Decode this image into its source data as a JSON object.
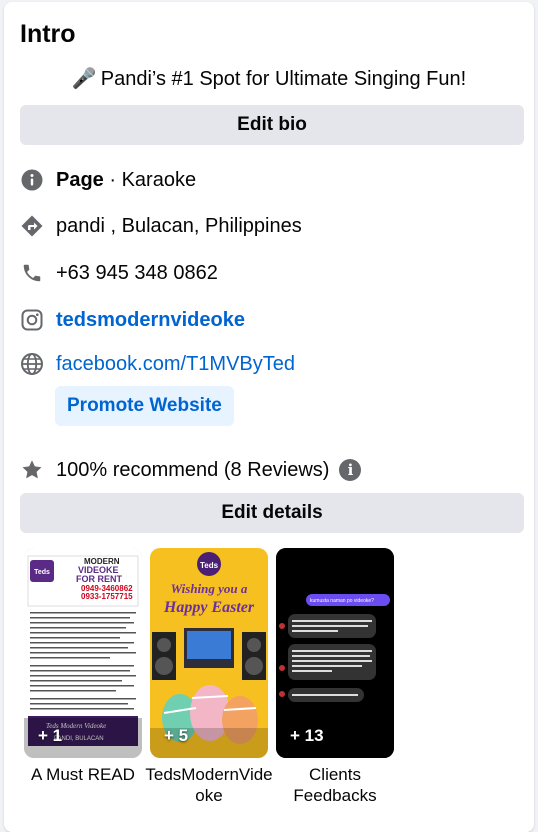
{
  "intro": {
    "title": "Intro",
    "bio_icon": "microphone-icon",
    "bio": "Pandi’s #1 Spot for Ultimate Singing Fun!",
    "edit_bio_label": "Edit bio"
  },
  "details": {
    "page_type_label": "Page",
    "page_type_sep": " · ",
    "category": "Karaoke",
    "location": "pandi , Bulacan, Philippines",
    "phone": "+63 945 348 0862",
    "instagram": "tedsmodernvideoke",
    "website": "facebook.com/T1MVByTed",
    "promote_label": "Promote Website",
    "recommend": "100% recommend (8 Reviews)",
    "edit_details_label": "Edit details"
  },
  "highlights": [
    {
      "count": "+ 1",
      "label": "A Must READ",
      "poster_lines": [
        "MODERN",
        "VIDEOKE",
        "FOR RENT",
        "0949-3460862",
        "0933-1757715"
      ],
      "footer": "Teds Modern Videoke",
      "footer_sub": "PANDI, BULACAN"
    },
    {
      "count": "+ 5",
      "label": "TedsModernVideoke",
      "line1": "Wishing you a",
      "line2": "Happy Easter"
    },
    {
      "count": "+ 13",
      "label": "Clients Feedbacks",
      "chat": [
        "kumusta naman po videoke?",
        "sobrang sulit po, mula ata nung dumating hindi natigil ng two nights straight 😊",
        "salamat po ulit, sa uulitin po ulit kami",
        "sobrang daming kumanta, feeling ko naman worth it ang presyo kasi updated yung songs kaya pati mga lolo at lola namatunda",
        "thank you po, sa uulitin 😊"
      ]
    }
  ],
  "colors": {
    "link": "#0064d1",
    "button_bg": "#e4e6eb",
    "promote_bg": "#e7f3ff",
    "icon_gray": "#65676b",
    "easter_bg": "#f6c020"
  }
}
